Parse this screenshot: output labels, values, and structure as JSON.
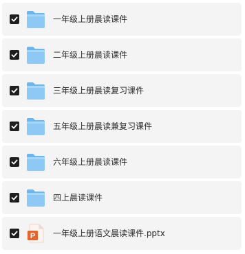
{
  "files": [
    {
      "name": "一年级上册晨读课件",
      "type": "folder",
      "checked": true,
      "icon": "folder-icon"
    },
    {
      "name": "二年级上册晨读课件",
      "type": "folder",
      "checked": true,
      "icon": "folder-icon"
    },
    {
      "name": "三年级上册晨读复习课件",
      "type": "folder",
      "checked": true,
      "icon": "folder-icon"
    },
    {
      "name": "五年级上册晨读兼复习课件",
      "type": "folder",
      "checked": true,
      "icon": "folder-icon"
    },
    {
      "name": "六年级上册晨读课件",
      "type": "folder",
      "checked": true,
      "icon": "folder-icon"
    },
    {
      "name": "四上晨读课件",
      "type": "folder",
      "checked": true,
      "icon": "folder-icon"
    },
    {
      "name": "一年级上册语文晨读课件.pptx",
      "type": "pptx",
      "checked": true,
      "icon": "powerpoint-file-icon",
      "badge": "P"
    }
  ],
  "colors": {
    "row_background": "#f4f4f5",
    "checkbox": "#1f1f1f",
    "folder": "#8ec9f5",
    "powerpoint": "#e0652f"
  }
}
